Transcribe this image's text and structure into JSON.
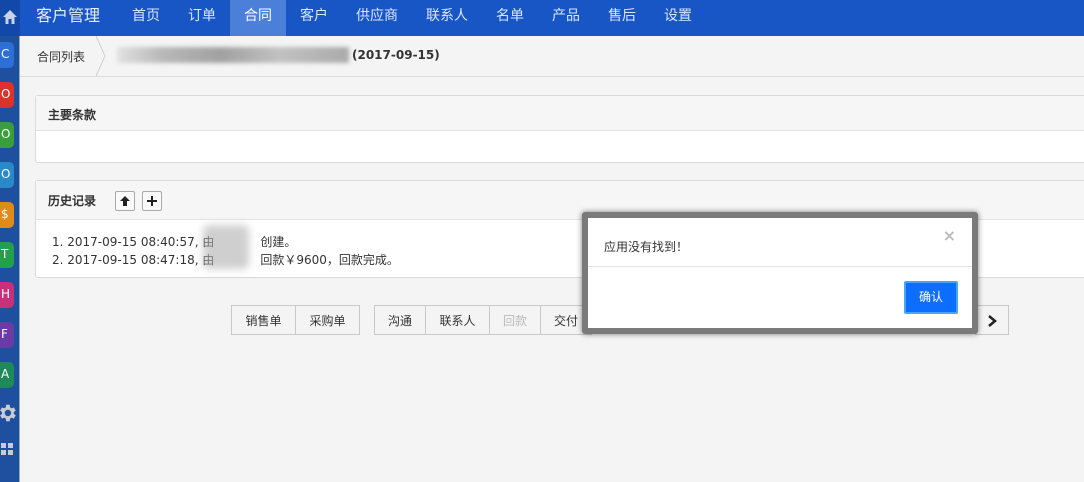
{
  "app": {
    "brand": "客户管理"
  },
  "nav": {
    "items": [
      "首页",
      "订单",
      "合同",
      "客户",
      "供应商",
      "联系人",
      "名单",
      "产品",
      "售后",
      "设置"
    ],
    "active_index": 2
  },
  "leftbar": {
    "items": [
      {
        "letter": "C",
        "color": "#2c6fd6"
      },
      {
        "letter": "O",
        "color": "#d9332a"
      },
      {
        "letter": "O",
        "color": "#3a9e3a"
      },
      {
        "letter": "O",
        "color": "#2a8ac7"
      },
      {
        "letter": "$",
        "color": "#e08a1a"
      },
      {
        "letter": "T",
        "color": "#22a04a"
      },
      {
        "letter": "H",
        "color": "#c8307a"
      },
      {
        "letter": "F",
        "color": "#6a3ba6"
      },
      {
        "letter": "A",
        "color": "#1e8a5a"
      }
    ]
  },
  "breadcrumb": {
    "list": "合同列表",
    "title_suffix": "(2017-09-15)"
  },
  "main_terms": {
    "title": "主要条款"
  },
  "history": {
    "title": "历史记录",
    "lines": [
      {
        "prefix": "1. 2017-09-15 08:40:57, 由",
        "suffix": "创建。"
      },
      {
        "prefix": "2. 2017-09-15 08:47:18, 由",
        "suffix": "回款￥9600，回款完成。"
      }
    ]
  },
  "buttons": {
    "group1": [
      "销售单",
      "采购单"
    ],
    "group2": [
      "沟通",
      "联系人",
      "回款",
      "交付"
    ]
  },
  "modal": {
    "message": "应用没有找到！",
    "close": "×",
    "ok": "确认"
  }
}
